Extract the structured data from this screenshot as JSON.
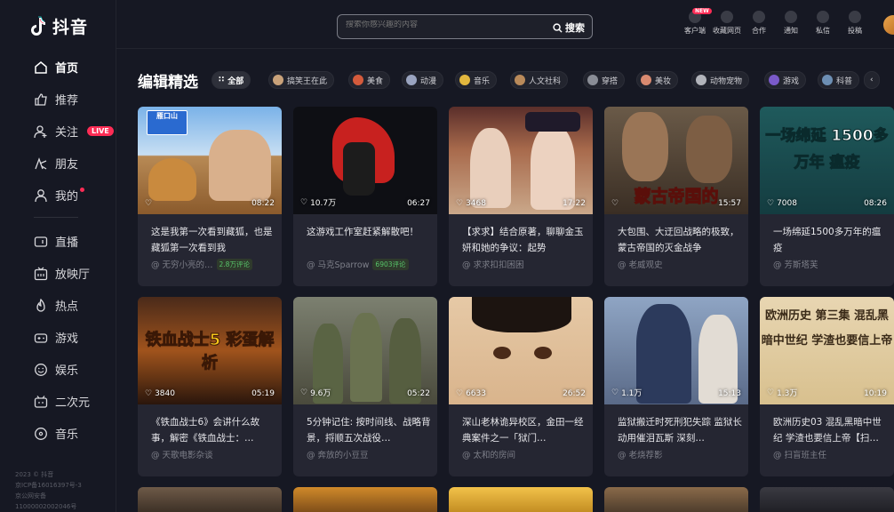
{
  "app": {
    "logo_text": "抖音"
  },
  "sidebar": {
    "items": [
      {
        "label": "首页"
      },
      {
        "label": "推荐"
      },
      {
        "label": "关注",
        "badge": "LIVE"
      },
      {
        "label": "朋友"
      },
      {
        "label": "我的"
      },
      {
        "label": "直播"
      },
      {
        "label": "放映厅"
      },
      {
        "label": "热点"
      },
      {
        "label": "游戏"
      },
      {
        "label": "娱乐"
      },
      {
        "label": "二次元"
      },
      {
        "label": "音乐"
      }
    ],
    "footer": [
      "2023 © 抖音",
      "京ICP备16016397号-3",
      "京公网安备",
      "11000002002046号"
    ]
  },
  "header": {
    "search_placeholder": "搜索你感兴趣的内容",
    "search_button": "搜索",
    "items": [
      {
        "label": "客户端",
        "badge": "NEW"
      },
      {
        "label": "收藏网页"
      },
      {
        "label": "合作"
      },
      {
        "label": "通知"
      },
      {
        "label": "私信"
      },
      {
        "label": "投稿"
      }
    ]
  },
  "main": {
    "title": "编辑精选",
    "chips": [
      "全部",
      "搞笑王在此",
      "美食",
      "动漫",
      "音乐",
      "人文社科",
      "穿搭",
      "美妆",
      "动物宠物",
      "游戏",
      "科普"
    ],
    "cards": [
      {
        "likes": "",
        "duration": "08:22",
        "title": "这是我第一次看到藏狐，也是藏狐第一次看到我",
        "author": "@ 无穷小亮的…",
        "count": "2.8万评论",
        "overlay": "雁口山"
      },
      {
        "likes": "10.7万",
        "duration": "06:27",
        "title": "这游戏工作室赶紧解散吧！",
        "author": "@ 马克Sparrow",
        "count": "6903评论",
        "overlay": ""
      },
      {
        "likes": "3468",
        "duration": "17:22",
        "title": "【求求】结合原著，聊聊金玉妍和她的争议：起势",
        "author": "@ 求求扣扣困困",
        "count": "",
        "overlay": ""
      },
      {
        "likes": "",
        "duration": "15:57",
        "title": "大包围、大迂回战略的极致，蒙古帝国的灭金战争",
        "author": "@ 老威观史",
        "count": "",
        "overlay": "蒙古帝国的"
      },
      {
        "likes": "7008",
        "duration": "08:26",
        "title": "一场绵延1500多万年的瘟疫",
        "author": "@ 芳斯塔芙",
        "count": "",
        "overlay": "一场绵延 1500多万年 瘟疫"
      },
      {
        "likes": "3840",
        "duration": "05:19",
        "title": "《铁血战士6》会讲什么故事，解密《铁血战士：…",
        "author": "@ 天歌电影杂谈",
        "count": "",
        "overlay": "铁血战士5 彩蛋解析"
      },
      {
        "likes": "9.6万",
        "duration": "05:22",
        "title": "5分钟记住: 按时间线、战略背景，捋顺五次战役…",
        "author": "@ 奔放的小豆豆",
        "count": "",
        "overlay": ""
      },
      {
        "likes": "6633",
        "duration": "26:52",
        "title": "深山老林诡异校区，金田一经典案件之一「狱门…",
        "author": "@ 太和的房间",
        "count": "",
        "overlay": ""
      },
      {
        "likes": "1.1万",
        "duration": "15:13",
        "title": "监狱搬迁时死刑犯失踪 监狱长动用催泪瓦斯 深刻…",
        "author": "@ 老烧荐影",
        "count": "",
        "overlay": ""
      },
      {
        "likes": "1.3万",
        "duration": "10:19",
        "title": "欧洲历史03 混乱黑暗中世纪 学渣也要信上帝【扫…",
        "author": "@ 扫盲班主任",
        "count": "",
        "overlay": "欧洲历史 第三集 混乱黑暗中世纪 学渣也要信上帝"
      }
    ]
  },
  "colors": {
    "bg": "#161823",
    "card": "#252632",
    "accent": "#fe2c55",
    "comment_green": "#57c56a"
  }
}
